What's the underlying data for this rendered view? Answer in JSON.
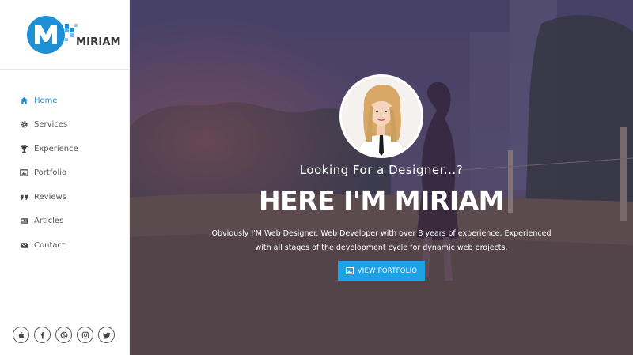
{
  "brand": {
    "name": "MIRIAM",
    "accent_color": "#1e90d6"
  },
  "nav": {
    "items": [
      {
        "label": "Home",
        "icon": "home-icon",
        "active": true
      },
      {
        "label": "Services",
        "icon": "gear-icon",
        "active": false
      },
      {
        "label": "Experience",
        "icon": "trophy-icon",
        "active": false
      },
      {
        "label": "Portfolio",
        "icon": "image-icon",
        "active": false
      },
      {
        "label": "Reviews",
        "icon": "quote-icon",
        "active": false
      },
      {
        "label": "Articles",
        "icon": "newspaper-icon",
        "active": false
      },
      {
        "label": "Contact",
        "icon": "envelope-icon",
        "active": false
      }
    ]
  },
  "socials": [
    {
      "icon": "apple-icon"
    },
    {
      "icon": "facebook-icon"
    },
    {
      "icon": "skype-icon"
    },
    {
      "icon": "instagram-icon"
    },
    {
      "icon": "twitter-icon"
    }
  ],
  "hero": {
    "tagline": "Looking For a Designer...?",
    "headline": "HERE I'M MIRIAM",
    "description_line1": "Obviously I'M Web Designer. Web Developer with over 8 years of experience. Experienced",
    "description_line2": "with all stages of the development cycle for dynamic web projects.",
    "cta_label": "VIEW PORTFOLIO",
    "cta_color": "#1ea1e6"
  }
}
